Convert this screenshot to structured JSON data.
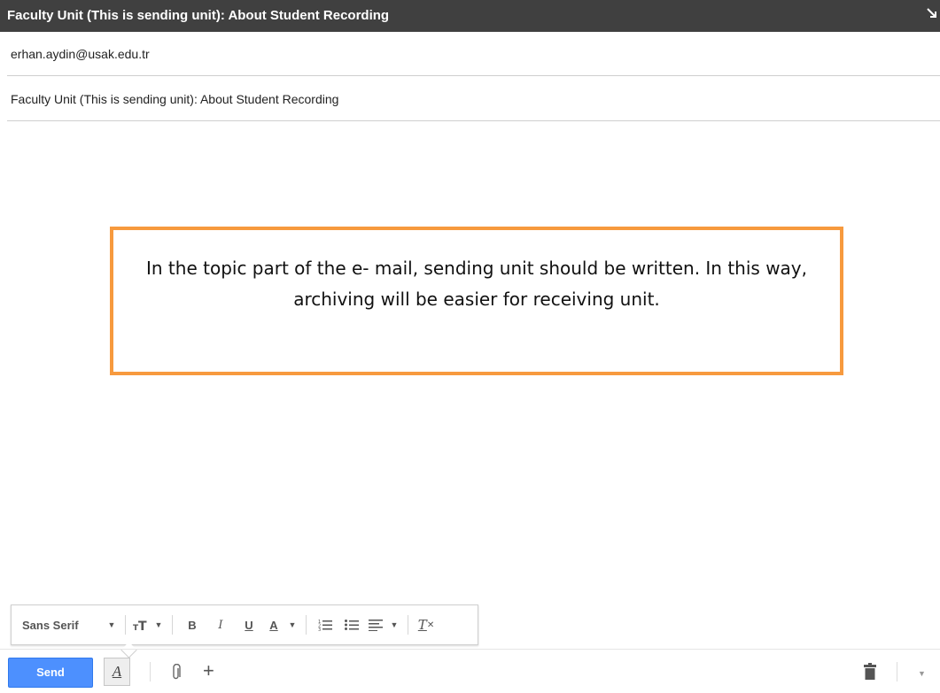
{
  "window": {
    "title": "Faculty Unit (This is sending unit): About Student Recording"
  },
  "compose": {
    "to_value": "erhan.aydin@usak.edu.tr",
    "subject_value": "Faculty Unit (This is sending unit): About Student Recording"
  },
  "callout": {
    "text": "In the topic part of the e- mail, sending unit should be written. In this way, archiving will be easier for receiving unit.",
    "border_color": "#f79a3e"
  },
  "format_toolbar": {
    "font_label": "Sans Serif",
    "size_icon": "text-size-icon",
    "bold_label": "B",
    "italic_label": "I",
    "underline_label": "U",
    "text_color_label": "A",
    "numbered_list_icon": "numbered-list-icon",
    "bulleted_list_icon": "bulleted-list-icon",
    "align_icon": "align-icon",
    "remove_format_label": "T"
  },
  "action_bar": {
    "send_label": "Send",
    "send_color": "#4d90fe",
    "formatting_label": "A",
    "more_label": "+"
  },
  "colors": {
    "titlebar": "#404040",
    "accent": "#4d90fe"
  }
}
